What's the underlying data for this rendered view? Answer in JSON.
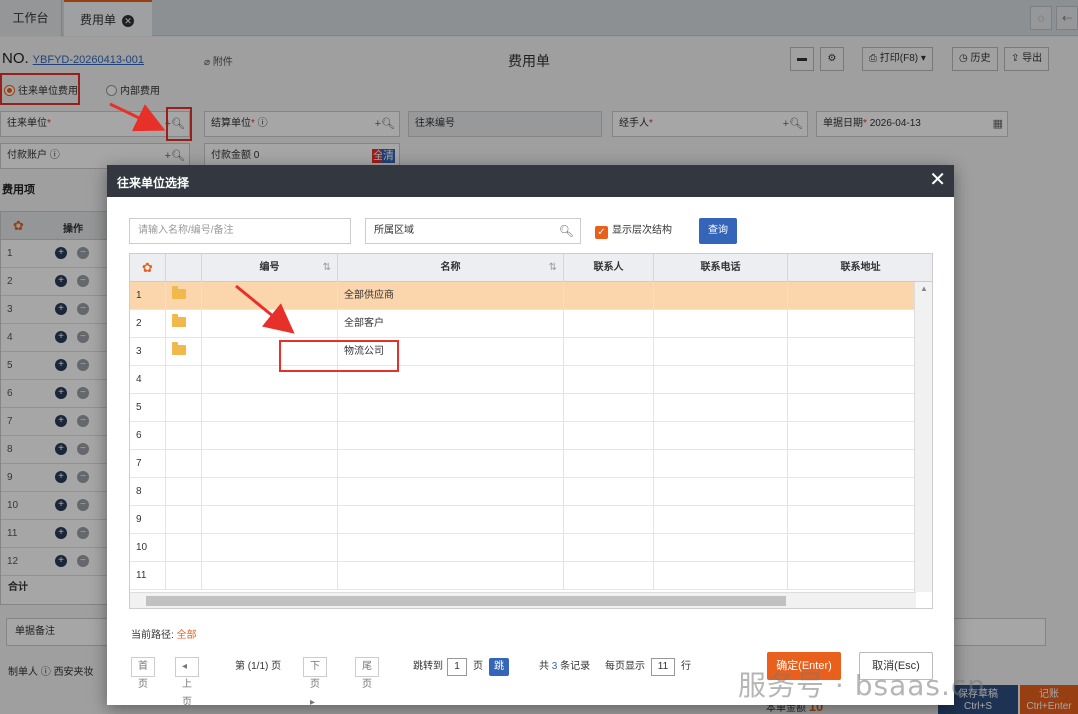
{
  "tabs": {
    "workbench": "工作台",
    "expense": "费用单"
  },
  "header": {
    "no_label": "NO.",
    "doc_no": "YBFYD-20260413-001",
    "attachment": "附件",
    "title": "费用单",
    "print": "打印(F8)",
    "history": "历史",
    "export": "导出"
  },
  "radios": {
    "partner_fee": "往来单位费用",
    "internal_fee": "内部费用"
  },
  "form": {
    "partner": "往来单位",
    "settle_unit": "结算单位",
    "partner_code": "往来编号",
    "handler": "经手人",
    "doc_date_label": "单据日期",
    "doc_date": "2026-04-13",
    "pay_account": "付款账户",
    "pay_amount_label": "付款金额",
    "pay_amount": "0",
    "pay_tag_1": "全",
    "pay_tag_2": "清"
  },
  "expense_section": {
    "label": "费用项",
    "op_header": "操作",
    "total": "合计"
  },
  "bottom": {
    "remark": "单据备注",
    "maker_label": "制单人",
    "maker": "西安夹妆",
    "amount_label": "本单金额",
    "amount": "10",
    "save_label": "保存草稿",
    "save_shortcut": "Ctrl+S",
    "post_label": "记账",
    "post_shortcut": "Ctrl+Enter"
  },
  "modal": {
    "title": "往来单位选择",
    "search_placeholder": "请输入名称/编号/备注",
    "region": "所属区域",
    "show_hierarchy": "显示层次结构",
    "query": "查询",
    "columns": [
      "编号",
      "名称",
      "联系人",
      "联系电话",
      "联系地址"
    ],
    "rows": [
      {
        "num": "1",
        "code": "",
        "name": "全部供应商",
        "folder": true
      },
      {
        "num": "2",
        "code": "",
        "name": "全部客户",
        "folder": true
      },
      {
        "num": "3",
        "code": "",
        "name": "物流公司",
        "folder": true
      },
      {
        "num": "4",
        "code": "",
        "name": "",
        "folder": false
      },
      {
        "num": "5",
        "code": "",
        "name": "",
        "folder": false
      },
      {
        "num": "6",
        "code": "",
        "name": "",
        "folder": false
      },
      {
        "num": "7",
        "code": "",
        "name": "",
        "folder": false
      },
      {
        "num": "8",
        "code": "",
        "name": "",
        "folder": false
      },
      {
        "num": "9",
        "code": "",
        "name": "",
        "folder": false
      },
      {
        "num": "10",
        "code": "",
        "name": "",
        "folder": false
      },
      {
        "num": "11",
        "code": "",
        "name": "",
        "folder": false
      }
    ],
    "path_label": "当前路径:",
    "path_value": "全部",
    "pager": {
      "first": "首页",
      "prev": "上页",
      "page_info": "第 (1/1) 页",
      "next": "下页",
      "last": "尾页",
      "jump_label": "跳转到",
      "jump_value": "1",
      "page_unit": "页",
      "go": "跳转",
      "total_pre": "共",
      "total_count": "3",
      "total_post": "条记录",
      "per_page_label": "每页显示",
      "per_page_value": "11",
      "row_unit": "行"
    },
    "ok": "确定(Enter)",
    "cancel": "取消(Esc)"
  },
  "watermark": "服务号 · bsaas.cn",
  "colors": {
    "accent": "#e8601c",
    "primary": "#3565b8",
    "highlight_row": "#fbd6ad",
    "annotation": "#e8302b"
  }
}
